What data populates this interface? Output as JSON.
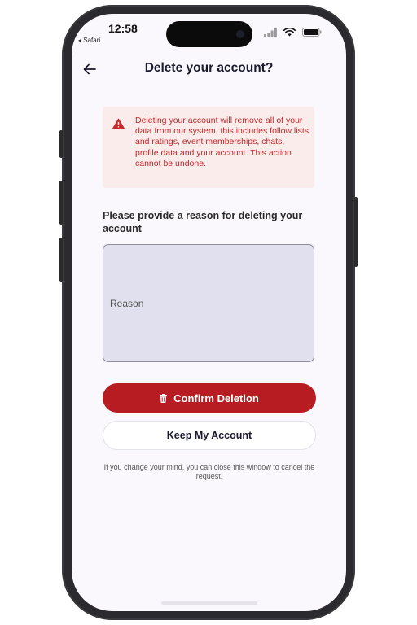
{
  "status_bar": {
    "time": "12:58",
    "back_app": "◂ Safari"
  },
  "header": {
    "title": "Delete your account?",
    "back_icon": "arrow-left-icon"
  },
  "warning": {
    "icon": "warning-triangle-icon",
    "text": "Deleting your account will remove all of your data from our system, this includes follow lists and ratings, event memberships, chats, profile data and your account. This action cannot be undone."
  },
  "form": {
    "reason_label": "Please provide a reason for deleting your account",
    "reason_placeholder": "Reason",
    "reason_value": ""
  },
  "actions": {
    "confirm_label": "Confirm Deletion",
    "confirm_icon": "trash-icon",
    "keep_label": "Keep My Account"
  },
  "footnote": "If you change your mind, you can close this window to cancel the request.",
  "colors": {
    "danger": "#b71c22",
    "warning_bg": "#fbecec",
    "warning_text": "#c62828",
    "input_bg": "#e0e0ef",
    "title": "#1a1a2e"
  }
}
